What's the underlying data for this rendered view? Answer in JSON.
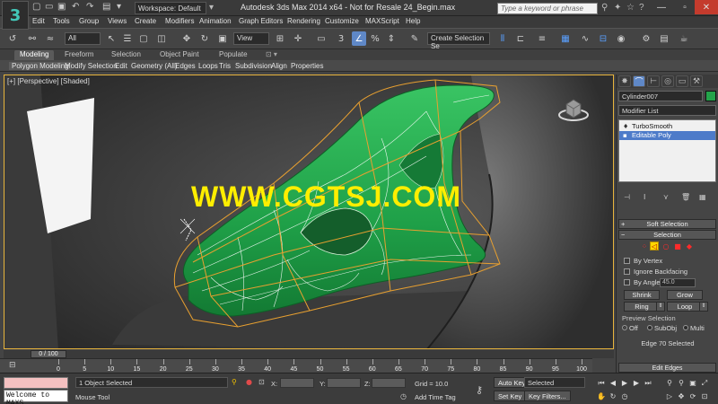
{
  "title_bar": {
    "app_icon": "3ds-max-logo",
    "workspace": "Workspace: Default",
    "title": "Autodesk 3ds Max  2014 x64  - Not for Resale   24_Begin.max",
    "search_placeholder": "Type a keyword or phrase"
  },
  "menu": [
    "Edit",
    "Tools",
    "Group",
    "Views",
    "Create",
    "Modifiers",
    "Animation",
    "Graph Editors",
    "Rendering",
    "Customize",
    "MAXScript",
    "Help"
  ],
  "toolbar": {
    "selection_filter": "All",
    "reference_coord": "View",
    "selection_set": "Create Selection Se"
  },
  "ribbon": {
    "tabs": [
      "Modeling",
      "Freeform",
      "Selection",
      "Object Paint",
      "Populate"
    ],
    "active_tab": "Modeling",
    "panels": [
      "Polygon Modeling",
      "Modify Selection",
      "Edit",
      "Geometry (All)",
      "Edges",
      "Loops",
      "Tris",
      "Subdivision",
      "Align",
      "Properties"
    ]
  },
  "viewport": {
    "label": "[+] [Perspective] [Shaded]",
    "watermark": "WWW.CGTSJ.COM",
    "mesh_color": "#22a84a",
    "cage_color": "#e8a030"
  },
  "command_panel": {
    "object_name": "Cylinder007",
    "object_color": "#23a34a",
    "modifier_list": "Modifier List",
    "stack": [
      {
        "label": "TurboSmooth",
        "selected": false
      },
      {
        "label": "Editable Poly",
        "selected": true
      }
    ],
    "soft_selection": "Soft Selection",
    "selection": "Selection",
    "by_vertex": "By Vertex",
    "ignore_backfacing": "Ignore Backfacing",
    "by_angle": "By Angle:",
    "angle_value": "45.0",
    "shrink": "Shrink",
    "grow": "Grow",
    "ring": "Ring",
    "loop": "Loop",
    "preview_selection": "Preview Selection",
    "preview_options": [
      "Off",
      "SubObj",
      "Multi"
    ],
    "preview_selected": "Off",
    "status": "Edge 70 Selected"
  },
  "timeline": {
    "slider": "0 / 100",
    "frame_current": 0,
    "frame_total": 100,
    "ticks": [
      "0",
      "5",
      "10",
      "15",
      "20",
      "25",
      "30",
      "35",
      "40",
      "45",
      "50",
      "55",
      "60",
      "65",
      "70",
      "75",
      "80",
      "85",
      "90",
      "95",
      "100"
    ]
  },
  "status_bar": {
    "maxscript": "Welcome to MAXS",
    "objects_selected": "1 Object Selected",
    "prompt": "Mouse Tool",
    "x_label": "X:",
    "y_label": "Y:",
    "z_label": "Z:",
    "grid": "Grid = 10.0",
    "add_time_tag": "Add Time Tag",
    "auto_key": "Auto Key",
    "set_key": "Set Key",
    "key_mode": "Selected",
    "key_filters": "Key Filters..."
  }
}
